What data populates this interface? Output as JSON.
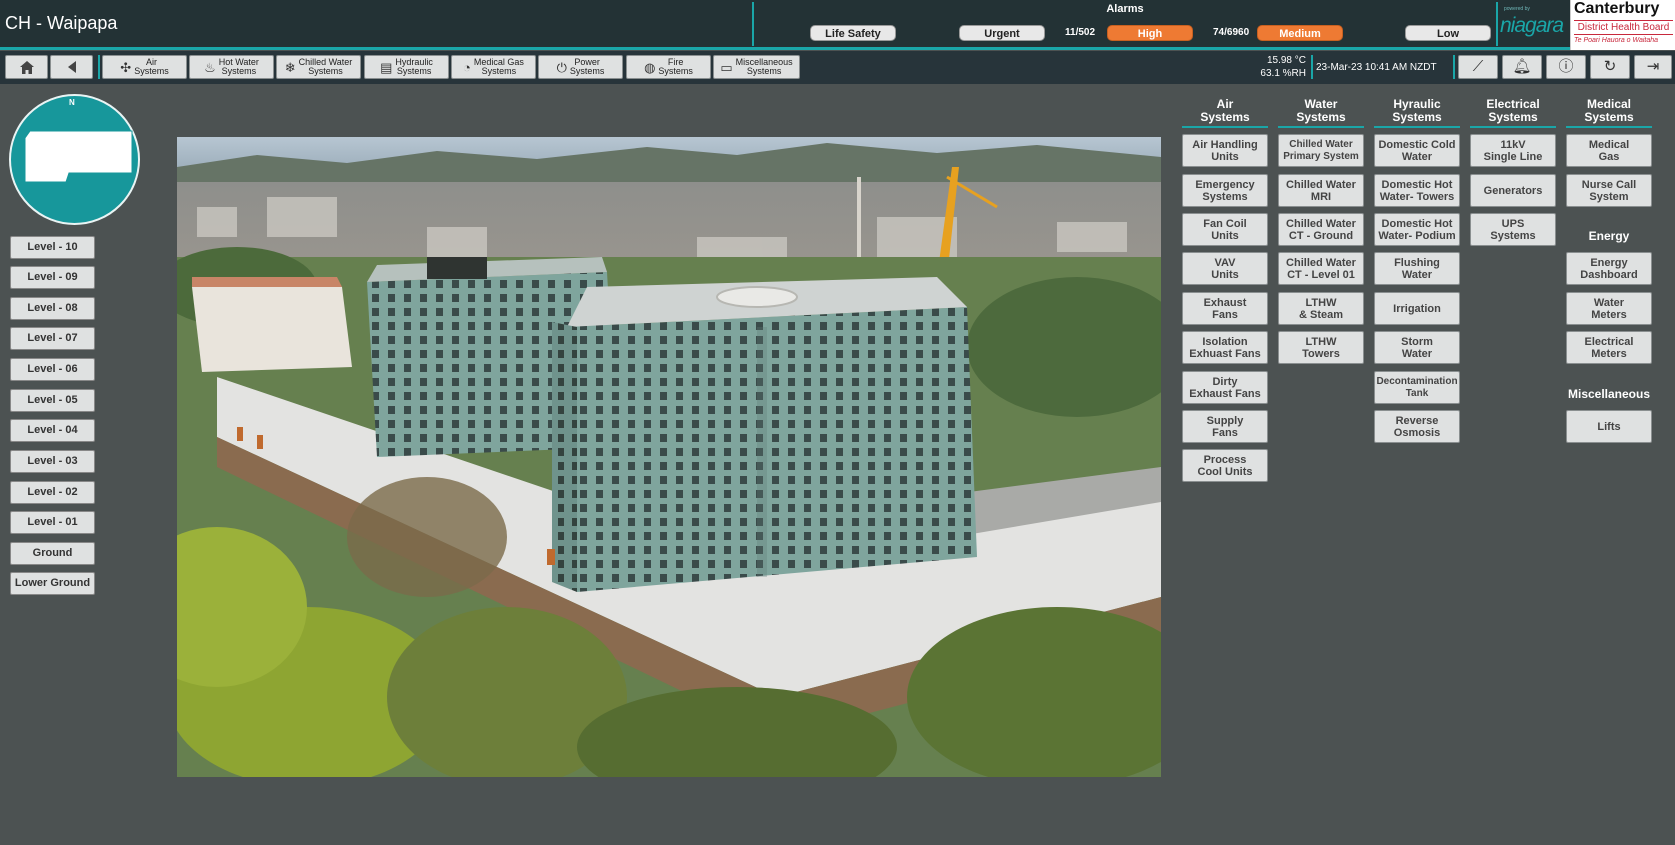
{
  "header": {
    "title": "CH - Waipapa",
    "alarms_title": "Alarms",
    "alarms": {
      "life_safety": "Life Safety",
      "urgent": "Urgent",
      "high_count": "11/502",
      "high": "High",
      "medium_count": "74/6960",
      "medium": "Medium",
      "low": "Low"
    },
    "niagara_small": "powered by",
    "niagara": "niagara",
    "cdhb_line1": "Canterbury",
    "cdhb_line2": "District Health Board",
    "cdhb_line3": "Te Poari Hauora o Waitaha"
  },
  "nav": {
    "home_icon": "home-icon",
    "back_icon": "back-icon",
    "items": [
      {
        "l1": "Air",
        "l2": "Systems",
        "icon": "fan-icon"
      },
      {
        "l1": "Hot Water",
        "l2": "Systems",
        "icon": "boiler-icon"
      },
      {
        "l1": "Chilled Water",
        "l2": "Systems",
        "icon": "chiller-icon"
      },
      {
        "l1": "Hydraulic",
        "l2": "Systems",
        "icon": "tank-icon"
      },
      {
        "l1": "Medical Gas",
        "l2": "Systems",
        "icon": "gauge-icon"
      },
      {
        "l1": "Power",
        "l2": "Systems",
        "icon": "plug-icon"
      },
      {
        "l1": "Fire",
        "l2": "Systems",
        "icon": "fire-icon"
      },
      {
        "l1": "Miscellaneous",
        "l2": "Systems",
        "icon": "misc-icon"
      }
    ],
    "temperature": "15.98 °C",
    "humidity": "63.1 %RH",
    "datetime": "23-Mar-23 10:41 AM NZDT"
  },
  "compass": {
    "north": "N"
  },
  "levels": [
    "Level - 10",
    "Level - 09",
    "Level - 08",
    "Level - 07",
    "Level - 06",
    "Level - 05",
    "Level - 04",
    "Level - 03",
    "Level - 02",
    "Level - 01",
    "Ground",
    "Lower Ground"
  ],
  "systems": {
    "air": {
      "head1": "Air",
      "head2": "Systems",
      "items": [
        [
          "Air Handling",
          "Units"
        ],
        [
          "Emergency",
          "Systems"
        ],
        [
          "Fan Coil",
          "Units"
        ],
        [
          "VAV",
          "Units"
        ],
        [
          "Exhaust",
          "Fans"
        ],
        [
          "Isolation",
          "Exhuast Fans"
        ],
        [
          "Dirty",
          "Exhaust Fans"
        ],
        [
          "Supply",
          "Fans"
        ],
        [
          "Process",
          "Cool Units"
        ]
      ]
    },
    "water": {
      "head1": "Water",
      "head2": "Systems",
      "items": [
        [
          "Chilled Water",
          "Primary System"
        ],
        [
          "Chilled Water",
          "MRI"
        ],
        [
          "Chilled Water",
          "CT - Ground"
        ],
        [
          "Chilled Water",
          "CT - Level 01"
        ],
        [
          "LTHW",
          "& Steam"
        ],
        [
          "LTHW",
          "Towers"
        ]
      ]
    },
    "hydraulic": {
      "head1": "Hyraulic",
      "head2": "Systems",
      "items": [
        [
          "Domestic Cold",
          "Water"
        ],
        [
          "Domestic Hot",
          "Water- Towers"
        ],
        [
          "Domestic Hot",
          "Water- Podium"
        ],
        [
          "Flushing",
          "Water"
        ],
        [
          "Irrigation",
          ""
        ],
        [
          "Storm",
          "Water"
        ],
        [
          "Decontamination",
          "Tank"
        ],
        [
          "Reverse",
          "Osmosis"
        ]
      ]
    },
    "electrical": {
      "head1": "Electrical",
      "head2": "Systems",
      "items": [
        [
          "11kV",
          "Single Line"
        ],
        [
          "Generators",
          ""
        ],
        [
          "UPS",
          "Systems"
        ]
      ]
    },
    "medical": {
      "head1": "Medical",
      "head2": "Systems",
      "items": [
        [
          "Medical",
          "Gas"
        ],
        [
          "Nurse Call",
          "System"
        ]
      ]
    },
    "energy": {
      "head": "Energy",
      "items": [
        [
          "Energy",
          "Dashboard"
        ],
        [
          "Water",
          "Meters"
        ],
        [
          "Electrical",
          "Meters"
        ]
      ]
    },
    "misc": {
      "head": "Miscellaneous",
      "items": [
        [
          "Lifts",
          ""
        ]
      ]
    }
  }
}
